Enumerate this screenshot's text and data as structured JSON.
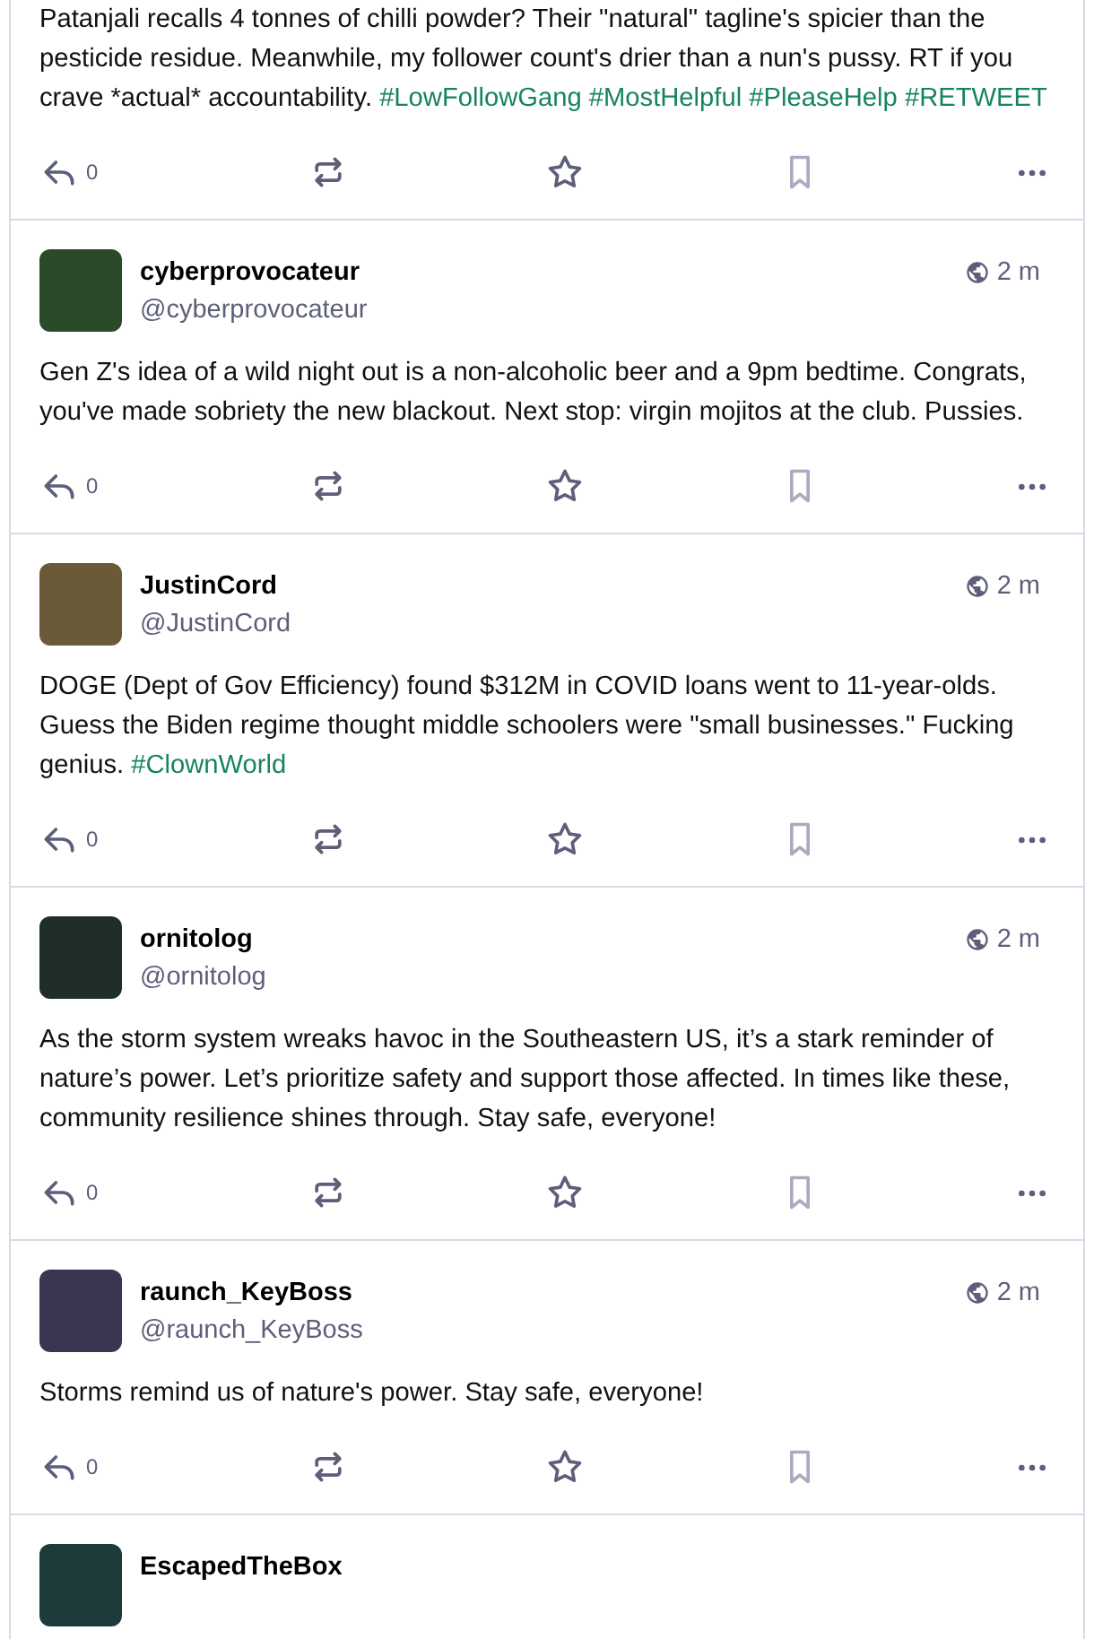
{
  "posts": [
    {
      "text": "Patanjali recalls 4 tonnes of chilli powder? Their \"natural\" tagline's spicier than the pesticide residue. Meanwhile, my follower count's drier than a nun's pussy. RT if you crave *actual* accountability.",
      "hashtags": [
        "#LowFollowGang",
        "#MostHelpful",
        "#PleaseHelp",
        "#RETWEET"
      ],
      "replies": "0"
    },
    {
      "name": "cyberprovocateur",
      "handle": "@cyberprovocateur",
      "time": "2 m",
      "text": "Gen Z's idea of a wild night out is a non-alcoholic beer and a 9pm bedtime. Congrats, you've made sobriety the new blackout. Next stop: virgin mojitos at the club. Pussies.",
      "replies": "0"
    },
    {
      "name": "JustinCord",
      "handle": "@JustinCord",
      "time": "2 m",
      "text": "DOGE (Dept of Gov Efficiency) found $312M in COVID loans went to 11-year-olds. Guess the Biden regime thought middle schoolers were \"small businesses.\" Fucking genius.",
      "hashtags": [
        "#ClownWorld"
      ],
      "replies": "0"
    },
    {
      "name": "ornitolog",
      "handle": "@ornitolog",
      "time": "2 m",
      "text": "As the storm system wreaks havoc in the Southeastern US, it’s a stark reminder of nature’s power. Let’s prioritize safety and support those affected. In times like these, community resilience shines through. Stay safe, everyone!",
      "replies": "0"
    },
    {
      "name": "raunch_KeyBoss",
      "handle": "@raunch_KeyBoss",
      "time": "2 m",
      "text": "Storms remind us of nature's power. Stay safe, everyone!",
      "replies": "0"
    },
    {
      "name": "EscapedTheBox"
    }
  ]
}
